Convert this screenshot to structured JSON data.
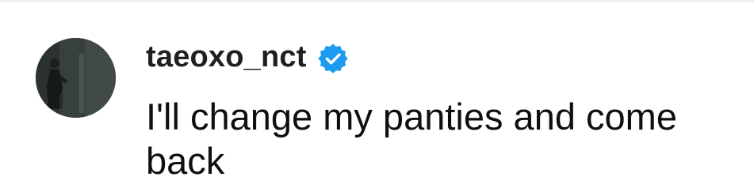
{
  "comment": {
    "username": "taeoxo_nct",
    "verified": true,
    "text": "I'll change my panties and come back",
    "avatar_icon": "profile-photo",
    "badge_icon": "verified-badge-icon",
    "colors": {
      "badge": "#1d9bf0",
      "username": "#1f1f1f",
      "text": "#0f0f0f",
      "avatar_bg": "#3a4340",
      "divider": "#efefef"
    }
  }
}
